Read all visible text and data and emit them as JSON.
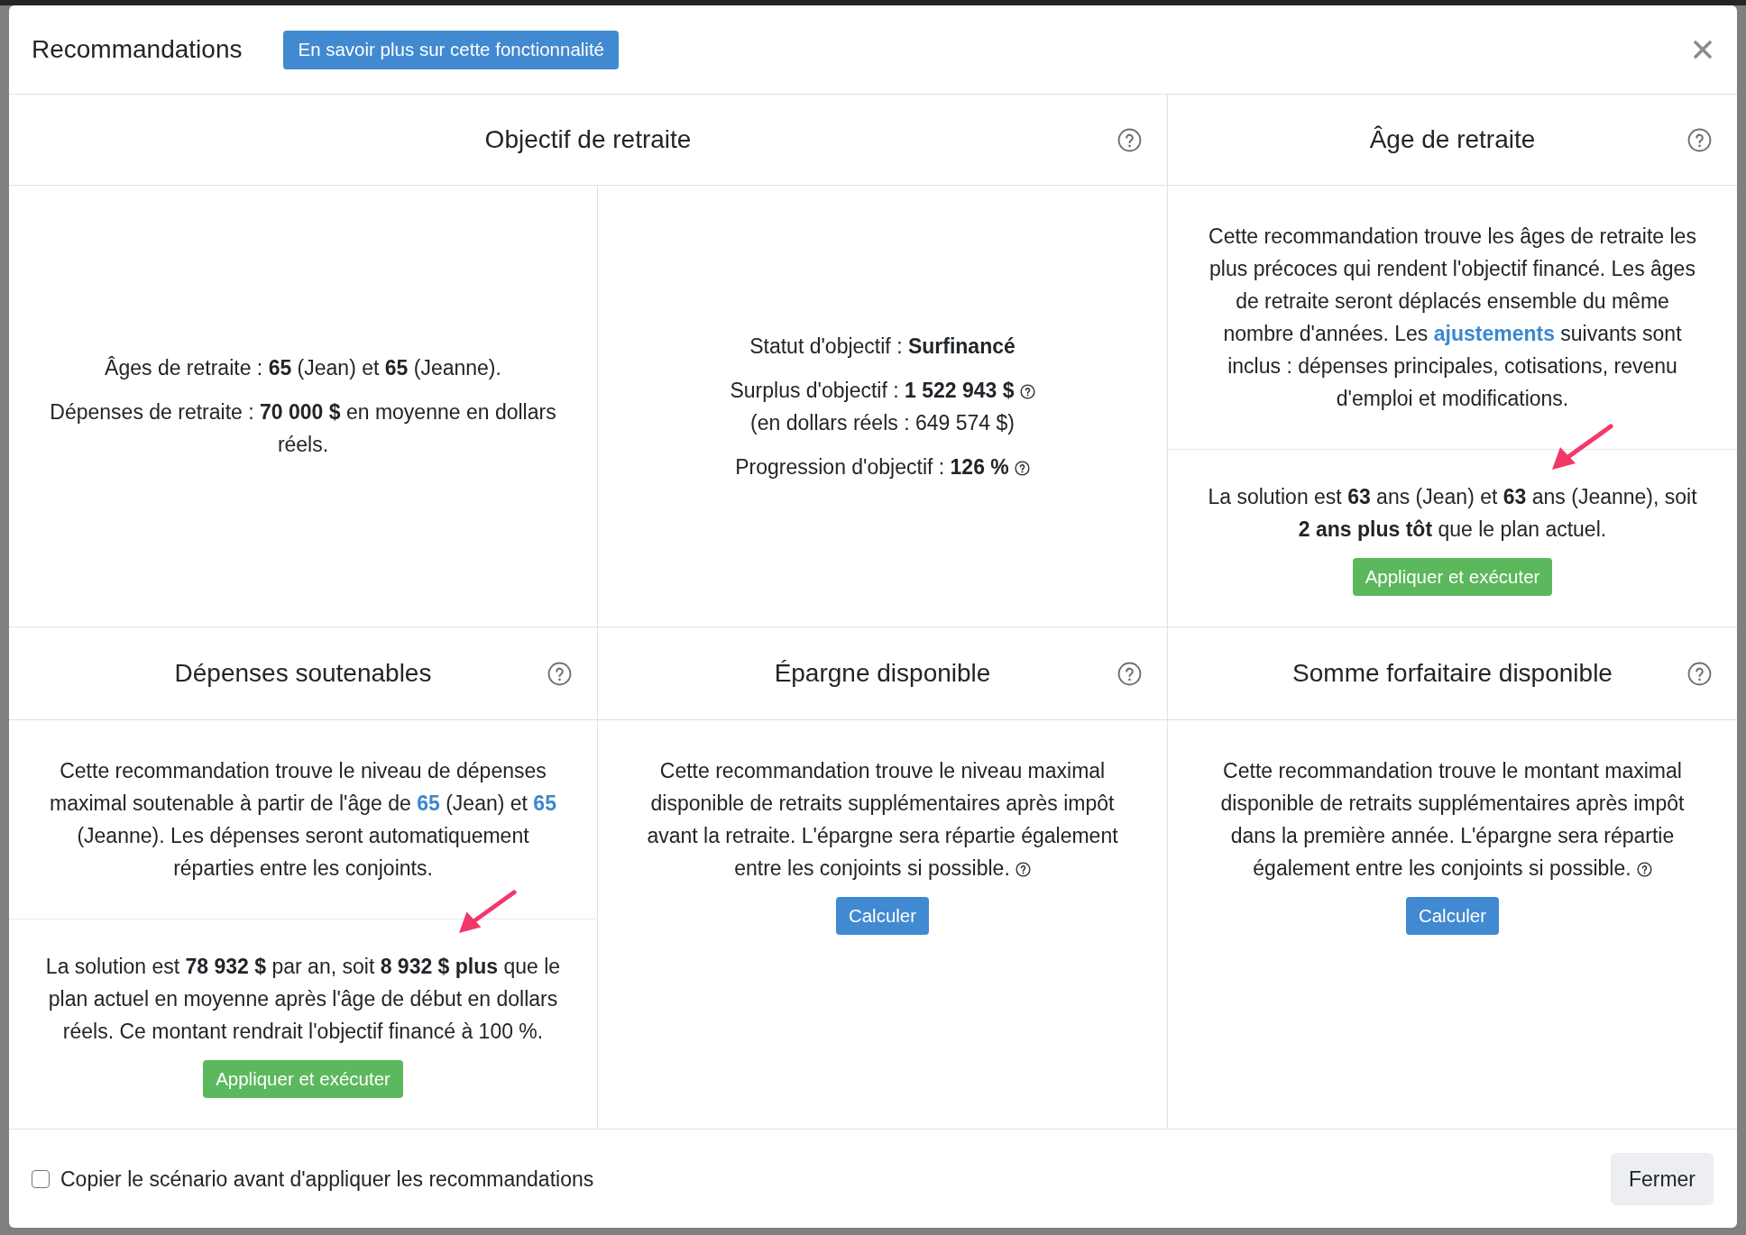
{
  "modal": {
    "title": "Recommandations",
    "learn_more_button": "En savoir plus sur cette fonctionnalité"
  },
  "goal_panel": {
    "title": "Objectif de retraite",
    "summary": [
      "Âges de retraite : **65** (Jean) et **65** (Jeanne).",
      "Dépenses de retraite : **70 000 $** en moyenne en dollars réels."
    ],
    "status": "Statut d'objectif : **Surfinancé**",
    "surplus": "Surplus d'objectif : **1 522 943 $**",
    "surplus_real": "(en dollars réels : 649 574 $)",
    "progress": "Progression d'objectif : **126 %**"
  },
  "retirement_age_panel": {
    "title": "Âge de retraite",
    "description": [
      {
        "kind": "text",
        "text": "Cette recommandation trouve les âges de retraite les plus précoces qui rendent l'objectif financé. Les âges de retraite seront déplacés ensemble du même nombre d'années. Les "
      },
      {
        "kind": "link",
        "text": "ajustements"
      },
      {
        "kind": "text",
        "text": " suivants sont inclus : dépenses principales, cotisations, revenu d'emploi et modifications."
      }
    ],
    "solution": "La solution est **63** ans (Jean) et **63** ans (Jeanne), soit **2 ans plus tôt** que le plan actuel.",
    "apply_button": "Appliquer et exécuter"
  },
  "sustainable_spending_panel": {
    "title": "Dépenses soutenables",
    "description": [
      {
        "kind": "text",
        "text": "Cette recommandation trouve le niveau de dépenses maximal soutenable à partir de l'âge de "
      },
      {
        "kind": "link",
        "text": "65"
      },
      {
        "kind": "text",
        "text": " (Jean) et "
      },
      {
        "kind": "link",
        "text": "65"
      },
      {
        "kind": "text",
        "text": " (Jeanne). Les dépenses seront automatiquement réparties entre les conjoints."
      }
    ],
    "solution": "La solution est **78 932 $** par an, soit **8 932 $ plus** que le plan actuel en moyenne après l'âge de début en dollars réels. Ce montant rendrait l'objectif financé à 100 %.",
    "apply_button": "Appliquer et exécuter"
  },
  "available_savings_panel": {
    "title": "Épargne disponible",
    "description": "Cette recommandation trouve le niveau maximal disponible de retraits supplémentaires après impôt avant la retraite. L'épargne sera répartie également entre les conjoints si possible.",
    "calculate_button": "Calculer"
  },
  "lump_sum_panel": {
    "title": "Somme forfaitaire disponible",
    "description": "Cette recommandation trouve le montant maximal disponible de retraits supplémentaires après impôt dans la première année. L'épargne sera répartie également entre les conjoints si possible.",
    "calculate_button": "Calculer"
  },
  "footer": {
    "copy_checkbox": {
      "label": "Copier le scénario avant d'appliquer les recommandations",
      "checked": false
    },
    "close_button": "Fermer"
  }
}
